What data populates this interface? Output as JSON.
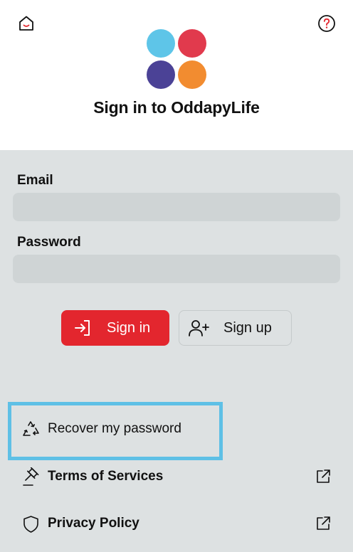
{
  "header": {
    "title": "Sign in to OddapyLife",
    "home_icon": "home-icon",
    "help_icon": "help-icon",
    "logo_colors": [
      "#5ec5e8",
      "#e13a4d",
      "#4b4296",
      "#f28c30"
    ]
  },
  "form": {
    "email_label": "Email",
    "email_value": "",
    "password_label": "Password",
    "password_value": ""
  },
  "actions": {
    "signin_label": "Sign in",
    "signup_label": "Sign up"
  },
  "links": {
    "recover_label": "Recover my password",
    "terms_label": "Terms of Services",
    "privacy_label": "Privacy Policy"
  },
  "colors": {
    "accent": "#e3262e",
    "highlight": "#5ec0e6",
    "panel": "#dde1e2"
  }
}
